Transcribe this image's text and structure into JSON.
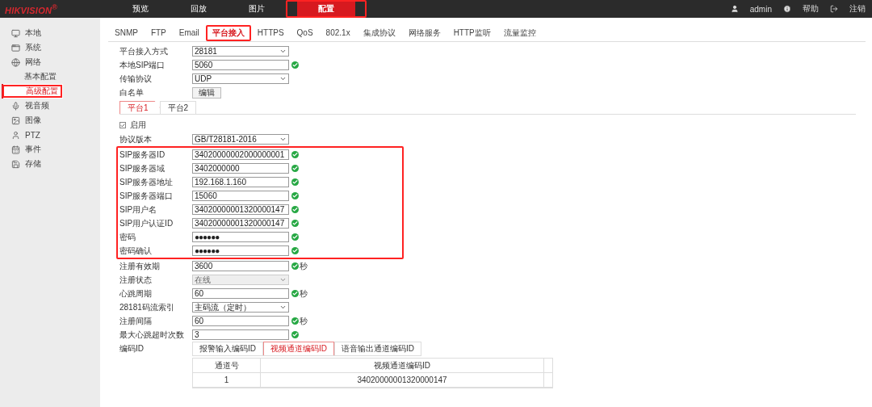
{
  "top_nav": {
    "logo": "HIKVISION",
    "logo_mark": "®",
    "items": [
      {
        "label": "预览",
        "selected": false,
        "highlighted": false
      },
      {
        "label": "回放",
        "selected": false,
        "highlighted": false
      },
      {
        "label": "图片",
        "selected": false,
        "highlighted": false
      },
      {
        "label": "配置",
        "selected": true,
        "highlighted": true
      }
    ],
    "user": "admin",
    "help": "帮助",
    "logout": "注销"
  },
  "sidebar": {
    "items": [
      {
        "label": "本地",
        "selected": false,
        "highlighted": false
      },
      {
        "label": "系统",
        "selected": false,
        "highlighted": false
      },
      {
        "label": "网络",
        "selected": false,
        "highlighted": false,
        "children": [
          {
            "label": "基本配置",
            "selected": false,
            "highlighted": false
          },
          {
            "label": "高级配置",
            "selected": true,
            "highlighted": true
          }
        ]
      },
      {
        "label": "视音频",
        "selected": false,
        "highlighted": false
      },
      {
        "label": "图像",
        "selected": false,
        "highlighted": false
      },
      {
        "label": "PTZ",
        "selected": false,
        "highlighted": false
      },
      {
        "label": "事件",
        "selected": false,
        "highlighted": false
      },
      {
        "label": "存储",
        "selected": false,
        "highlighted": false
      }
    ]
  },
  "tabs": [
    {
      "label": "SNMP",
      "selected": false,
      "highlighted": false
    },
    {
      "label": "FTP",
      "selected": false,
      "highlighted": false
    },
    {
      "label": "Email",
      "selected": false,
      "highlighted": false
    },
    {
      "label": "平台接入",
      "selected": true,
      "highlighted": true
    },
    {
      "label": "HTTPS",
      "selected": false,
      "highlighted": false
    },
    {
      "label": "QoS",
      "selected": false,
      "highlighted": false
    },
    {
      "label": "802.1x",
      "selected": false,
      "highlighted": false
    },
    {
      "label": "集成协议",
      "selected": false,
      "highlighted": false
    },
    {
      "label": "网络服务",
      "selected": false,
      "highlighted": false
    },
    {
      "label": "HTTP监听",
      "selected": false,
      "highlighted": false
    },
    {
      "label": "流量监控",
      "selected": false,
      "highlighted": false
    }
  ],
  "general_rows": [
    {
      "label": "平台接入方式",
      "kind": "select",
      "value": "28181",
      "disabled": false
    },
    {
      "label": "本地SIP端口",
      "kind": "input",
      "value": "5060",
      "valid": true
    },
    {
      "label": "传输协议",
      "kind": "select",
      "value": "UDP",
      "disabled": false
    },
    {
      "label": "白名单",
      "kind": "button",
      "value": "编辑"
    }
  ],
  "platform_tabs": [
    {
      "label": "平台1",
      "selected": true
    },
    {
      "label": "平台2",
      "selected": false
    }
  ],
  "enable": {
    "label": "启用",
    "checked": true
  },
  "version_row": {
    "label": "协议版本",
    "kind": "select",
    "value": "GB/T28181-2016",
    "disabled": false
  },
  "sip_group": {
    "highlighted": true,
    "rows": [
      {
        "label": "SIP服务器ID",
        "kind": "input",
        "value": "34020000002000000001",
        "valid": true
      },
      {
        "label": "SIP服务器域",
        "kind": "input",
        "value": "3402000000",
        "valid": true
      },
      {
        "label": "SIP服务器地址",
        "kind": "input",
        "value": "192.168.1.160",
        "valid": true
      },
      {
        "label": "SIP服务器端口",
        "kind": "input",
        "value": "15060",
        "valid": true
      },
      {
        "label": "SIP用户名",
        "kind": "input",
        "value": "34020000001320000147",
        "valid": true
      },
      {
        "label": "SIP用户认证ID",
        "kind": "input",
        "value": "34020000001320000147",
        "valid": true
      },
      {
        "label": "密码",
        "kind": "password",
        "value": "●●●●●●",
        "valid": true
      },
      {
        "label": "密码确认",
        "kind": "password",
        "value": "●●●●●●",
        "valid": true
      }
    ]
  },
  "more_rows": [
    {
      "label": "注册有效期",
      "kind": "input",
      "value": "3600",
      "valid": true,
      "unit": "秒"
    },
    {
      "label": "注册状态",
      "kind": "select",
      "value": "在线",
      "disabled": true
    },
    {
      "label": "心跳周期",
      "kind": "input",
      "value": "60",
      "valid": true,
      "unit": "秒"
    },
    {
      "label": "28181码流索引",
      "kind": "select",
      "value": "主码流（定时）",
      "disabled": false
    },
    {
      "label": "注册间隔",
      "kind": "input",
      "value": "60",
      "valid": true,
      "unit": "秒"
    },
    {
      "label": "最大心跳超时次数",
      "kind": "input",
      "value": "3",
      "valid": true
    }
  ],
  "code_id": {
    "label": "编码ID",
    "tabs": [
      {
        "label": "报警输入编码ID",
        "selected": false
      },
      {
        "label": "视频通道编码ID",
        "selected": true
      },
      {
        "label": "语音输出通道编码ID",
        "selected": false
      }
    ],
    "table": {
      "columns": [
        "通道号",
        "视频通道编码ID"
      ],
      "rows": [
        [
          "1",
          "34020000001320000147"
        ]
      ]
    }
  }
}
